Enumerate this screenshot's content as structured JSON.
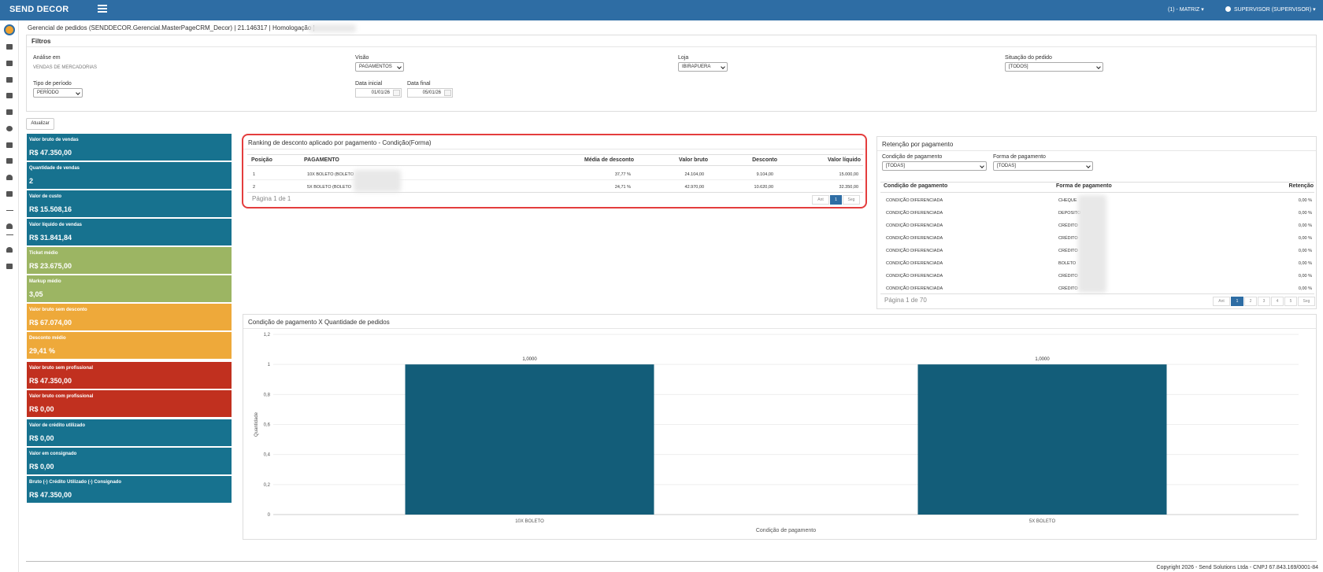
{
  "app": {
    "brand": "SEND DECOR",
    "branch": "(1) - MATRIZ",
    "user": "SUPERVISOR (SUPERVISOR)"
  },
  "page_title": "Gerencial de pedidos (SENDDECOR.Gerencial.MasterPageCRM_Decor) | 21.146317 | Homologação |",
  "filters": {
    "title": "Filtros",
    "analise_label": "Análise em",
    "analise_value": "VENDAS DE MERCADORIAS",
    "visao_label": "Visão",
    "visao_value": "PAGAMENTOS",
    "loja_label": "Loja",
    "loja_value": "IBIRAPUERA",
    "situacao_label": "Situação do pedido",
    "situacao_value": "[TODOS]",
    "tipo_label": "Tipo de período",
    "tipo_value": "PERÍODO",
    "data_inicial_label": "Data inicial",
    "data_inicial_value": "01/01/26",
    "data_final_label": "Data final",
    "data_final_value": "05/01/26",
    "update_button": "Atualizar"
  },
  "tiles": [
    {
      "label": "Valor bruto de vendas",
      "value": "R$ 47.350,00",
      "color": "#17728f"
    },
    {
      "label": "Quantidade de vendas",
      "value": "2",
      "color": "#17728f"
    },
    {
      "label": "Valor de custo",
      "value": "R$ 15.508,16",
      "color": "#17728f"
    },
    {
      "label": "Valor líquido de vendas",
      "value": "R$ 31.841,84",
      "color": "#17728f"
    },
    {
      "label": "Ticket médio",
      "value": "R$ 23.675,00",
      "color": "#9cb563"
    },
    {
      "label": "Markup médio",
      "value": "3,05",
      "color": "#9cb563"
    },
    {
      "label": "Valor bruto sem desconto",
      "value": "R$ 67.074,00",
      "color": "#eea93a"
    },
    {
      "label": "Desconto médio",
      "value": "29,41 %",
      "color": "#eea93a"
    },
    {
      "label": "Valor bruto sem profissional",
      "value": "R$ 47.350,00",
      "color": "#c1301f"
    },
    {
      "label": "Valor bruto com profissional",
      "value": "R$ 0,00",
      "color": "#c1301f"
    },
    {
      "label": "Valor de crédito utilizado",
      "value": "R$ 0,00",
      "color": "#17728f"
    },
    {
      "label": "Valor em consignado",
      "value": "R$ 0,00",
      "color": "#17728f"
    },
    {
      "label": "Bruto (-) Crédito Utilizado (-) Consignado",
      "value": "R$ 47.350,00",
      "color": "#17728f"
    }
  ],
  "ranking": {
    "title": "Ranking de desconto aplicado por pagamento - Condição(Forma)",
    "columns": [
      "Posição",
      "PAGAMENTO",
      "Média de desconto",
      "Valor bruto",
      "Desconto",
      "Valor líquido"
    ],
    "rows": [
      [
        "1",
        "10X BOLETO (BOLETO",
        "37,77 %",
        "24.104,00",
        "9.104,00",
        "15.000,00"
      ],
      [
        "2",
        "5X BOLETO (BOLETO ",
        "24,71 %",
        "42.970,00",
        "10.620,00",
        "32.350,00"
      ]
    ],
    "pager_text": "Página 1 de 1",
    "pager": [
      "Ant",
      "1",
      "Seg"
    ]
  },
  "retencao": {
    "title": "Retenção por pagamento",
    "condicao_label": "Condição de pagamento",
    "condicao_value": "[TODAS]",
    "forma_label": "Forma de pagamento",
    "forma_value": "[TODAS]",
    "columns": [
      "Condição de pagamento",
      "Forma de pagamento",
      "Retenção"
    ],
    "rows": [
      [
        "CONDIÇÃO DIFERENCIADA",
        "CHEQUE",
        "0,00 %"
      ],
      [
        "CONDIÇÃO DIFERENCIADA",
        "DEPOSITO",
        "0,00 %"
      ],
      [
        "CONDIÇÃO DIFERENCIADA",
        "CRÉDITO ",
        "0,00 %"
      ],
      [
        "CONDIÇÃO DIFERENCIADA",
        "CRÉDITO ",
        "0,00 %"
      ],
      [
        "CONDIÇÃO DIFERENCIADA",
        "CRÉDITO ",
        "0,00 %"
      ],
      [
        "CONDIÇÃO DIFERENCIADA",
        "BOLETO ",
        "0,00 %"
      ],
      [
        "CONDIÇÃO DIFERENCIADA",
        "CRÉDITO ",
        "0,00 %"
      ],
      [
        "CONDIÇÃO DIFERENCIADA",
        "CRÉDITO ",
        "0,00 %"
      ]
    ],
    "pager_text": "Página 1 de 70",
    "pager": [
      "Ant",
      "1",
      "2",
      "3",
      "4",
      "5",
      "Seg"
    ]
  },
  "chart_panel": {
    "title": "Condição de pagamento X Quantidade de pedidos"
  },
  "chart_data": {
    "type": "bar",
    "categories": [
      "10X BOLETO",
      "5X BOLETO"
    ],
    "values": [
      1,
      1
    ],
    "data_labels": [
      "1,0000",
      "1,0000"
    ],
    "xlabel": "Condição de pagamento",
    "ylabel": "Quantidade",
    "ylim": [
      0,
      1.2
    ],
    "yticks": [
      "0",
      "0,2",
      "0,4",
      "0,6",
      "0,8",
      "1",
      "1,2"
    ],
    "grid": true,
    "bar_color": "#135d79"
  },
  "footer": "Copyright 2026 - Send Solutions Ltda - CNPJ 67.843.169/0001-84"
}
